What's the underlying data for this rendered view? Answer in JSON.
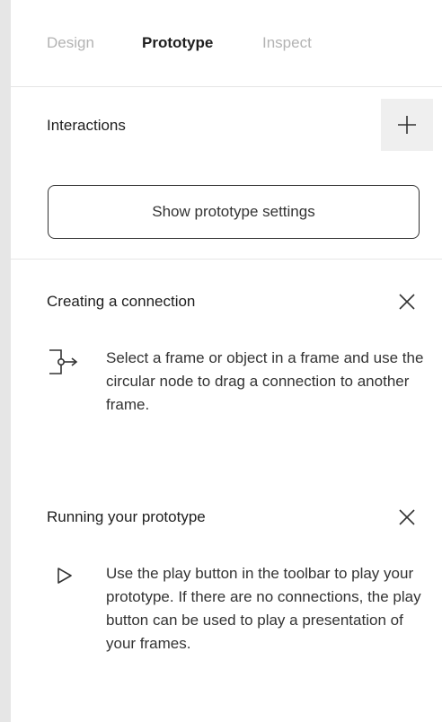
{
  "tabs": [
    {
      "label": "Design",
      "active": false
    },
    {
      "label": "Prototype",
      "active": true
    },
    {
      "label": "Inspect",
      "active": false
    }
  ],
  "interactions": {
    "title": "Interactions",
    "add_icon": "plus-icon",
    "settings_button_label": "Show prototype settings"
  },
  "help": {
    "connection": {
      "title": "Creating a connection",
      "icon": "connection-arrow-icon",
      "body": "Select a frame or object in a frame and use the circular node to drag a connection to another frame."
    },
    "running": {
      "title": "Running your prototype",
      "icon": "play-icon",
      "body": "Use the play button in the toolbar to play your prototype. If there are no connections, the play button can be used to play a presentation of your frames."
    }
  },
  "colors": {
    "active_tab": "#1e1e1e",
    "inactive_tab": "#b3b3b3",
    "divider": "#e6e6e6",
    "add_button_bg": "#efefef"
  }
}
